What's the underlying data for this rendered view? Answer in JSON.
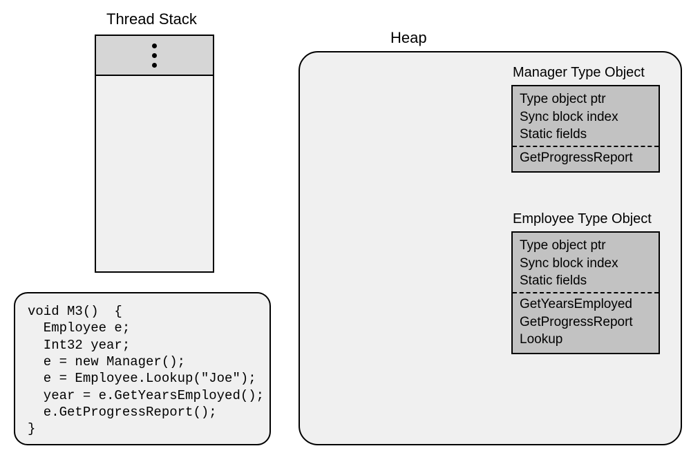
{
  "labels": {
    "threadStack": "Thread Stack",
    "heap": "Heap"
  },
  "managerObject": {
    "title": "Manager Type Object",
    "header1": "Type object ptr",
    "header2": "Sync block index",
    "header3": "Static fields",
    "method1": "GetProgressReport"
  },
  "employeeObject": {
    "title": "Employee Type Object",
    "header1": "Type object ptr",
    "header2": "Sync block index",
    "header3": "Static fields",
    "method1": "GetYearsEmployed",
    "method2": "GetProgressReport",
    "method3": "Lookup"
  },
  "code": {
    "line1": "void M3()  {",
    "line2": "  Employee e;",
    "line3": "  Int32 year;",
    "line4": "  e = new Manager();",
    "line5": "  e = Employee.Lookup(\"Joe\");",
    "line6": "  year = e.GetYearsEmployed();",
    "line7": "  e.GetProgressReport();",
    "line8": "}"
  }
}
